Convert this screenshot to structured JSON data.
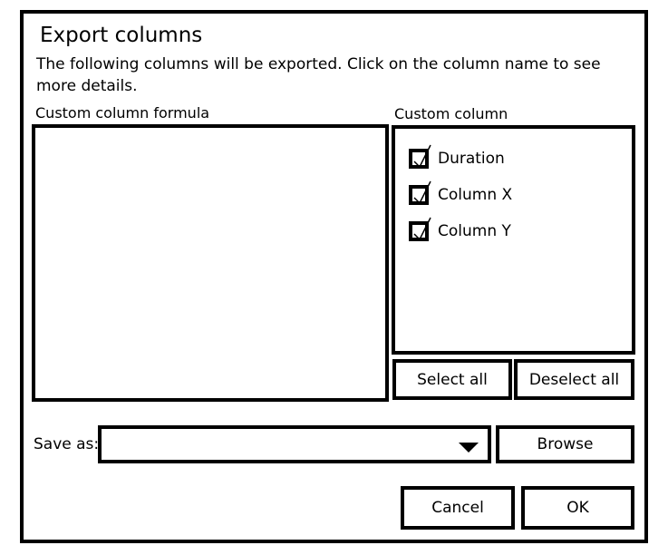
{
  "dialog": {
    "title": "Export columns",
    "description": "The following columns will be  exported. Click on the column name to see more details."
  },
  "formula_panel": {
    "label": "Custom column formula"
  },
  "columns_panel": {
    "label": "Custom column",
    "items": [
      {
        "label": "Duration",
        "checked": true
      },
      {
        "label": "Column X",
        "checked": true
      },
      {
        "label": "Column Y",
        "checked": true
      }
    ],
    "select_all_label": "Select all",
    "deselect_all_label": "Deselect all"
  },
  "save": {
    "label": "Save as:",
    "value": "",
    "browse_label": "Browse"
  },
  "footer": {
    "cancel_label": "Cancel",
    "ok_label": "OK"
  },
  "icons": {
    "dropdown": "chevron-down-icon",
    "checkbox": "checkbox-checked-icon"
  }
}
